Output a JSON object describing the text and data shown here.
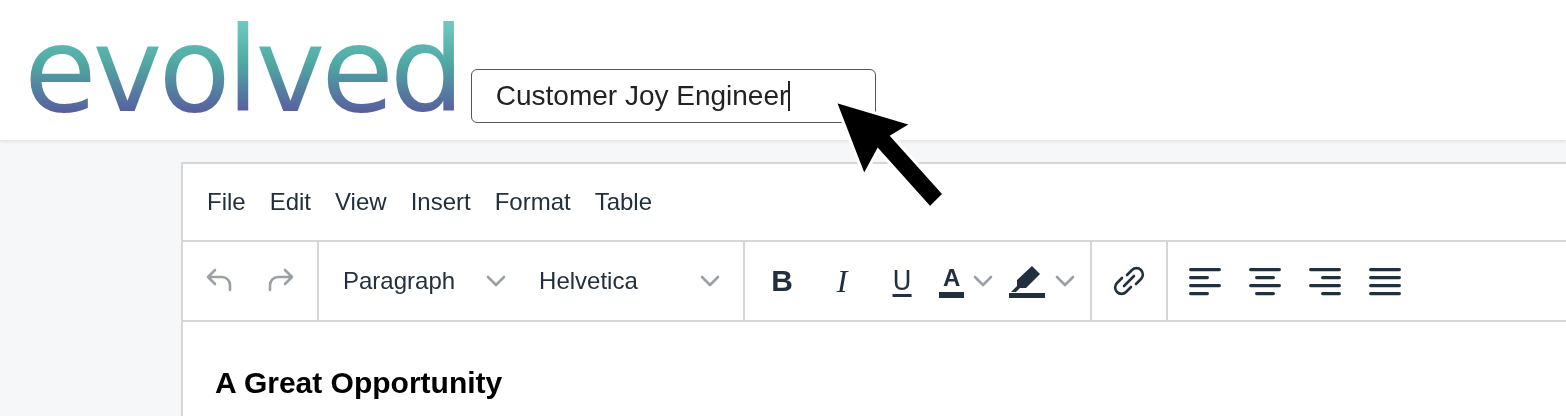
{
  "logo": {
    "text": "evolved"
  },
  "job_title_field": {
    "value": "Customer Joy Engineer"
  },
  "editor": {
    "menubar": [
      {
        "label": "File"
      },
      {
        "label": "Edit"
      },
      {
        "label": "View"
      },
      {
        "label": "Insert"
      },
      {
        "label": "Format"
      },
      {
        "label": "Table"
      }
    ],
    "toolbar": [
      {
        "items": [
          {
            "kind": "undo",
            "disabled": true
          },
          {
            "kind": "redo",
            "disabled": true
          }
        ]
      },
      {
        "items": [
          {
            "kind": "select",
            "label": "Paragraph",
            "disabled": false
          },
          {
            "kind": "select",
            "label": "Helvetica",
            "disabled": false
          }
        ]
      },
      {
        "items": [
          {
            "kind": "bold",
            "label": "B",
            "disabled": false
          },
          {
            "kind": "italic",
            "label": "I",
            "disabled": false
          },
          {
            "kind": "underline",
            "label": "U",
            "disabled": false
          },
          {
            "kind": "forecolor",
            "label": "A",
            "disabled": false
          },
          {
            "kind": "highlight",
            "disabled": false
          }
        ]
      },
      {
        "items": [
          {
            "kind": "link",
            "disabled": false
          }
        ]
      },
      {
        "items": [
          {
            "kind": "align-left",
            "disabled": false
          },
          {
            "kind": "align-center",
            "disabled": false
          },
          {
            "kind": "align-right",
            "disabled": false
          },
          {
            "kind": "justify",
            "disabled": false
          }
        ]
      }
    ],
    "content": {
      "heading": "A Great Opportunity"
    }
  }
}
